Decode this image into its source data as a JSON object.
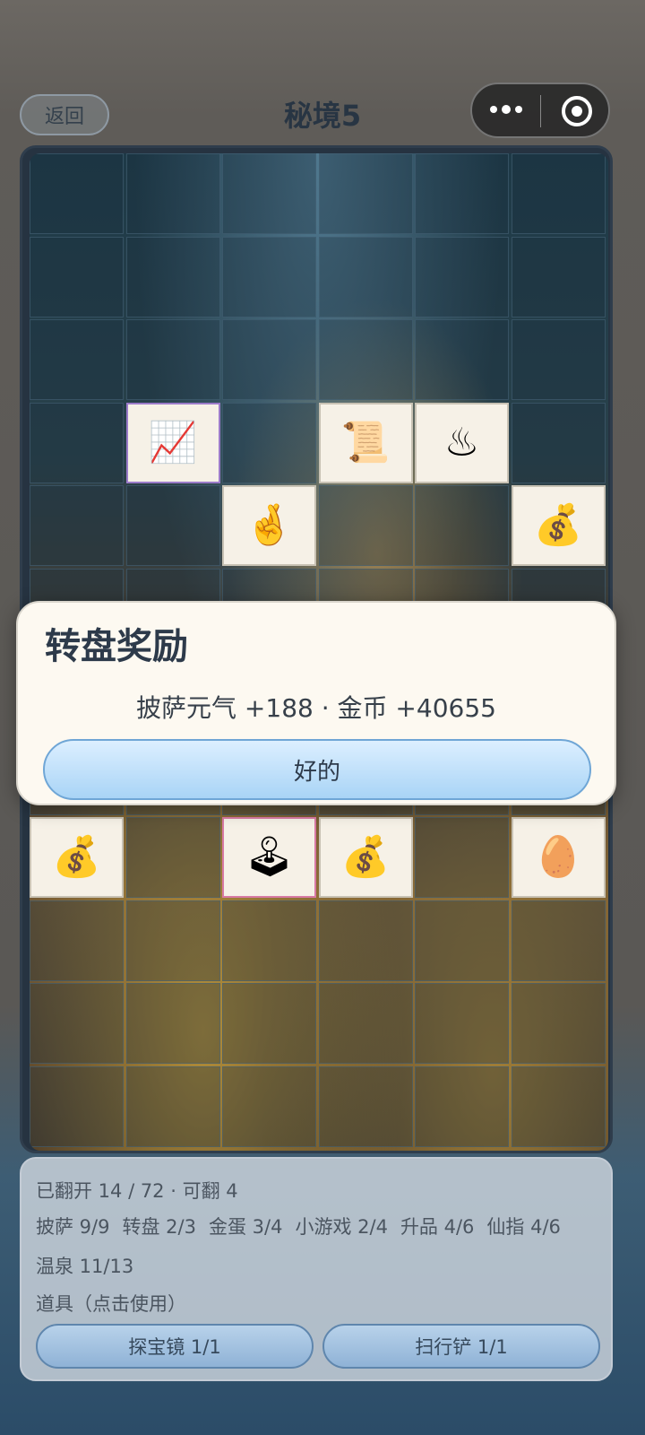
{
  "header": {
    "back_label": "返回",
    "title": "秘境5"
  },
  "board": {
    "revealed_tiles": [
      {
        "name": "upgrade-tile",
        "icon": "upgrade-steps-icon",
        "row": 3,
        "col": 1,
        "glyph": "📈",
        "border": "purple"
      },
      {
        "name": "scroll-tile",
        "icon": "scroll-list-icon",
        "row": 3,
        "col": 3,
        "glyph": "📜",
        "border": "plain"
      },
      {
        "name": "hot-spring-tile",
        "icon": "hot-spring-pool-icon",
        "row": 3,
        "col": 4,
        "glyph": "♨",
        "border": "plain"
      },
      {
        "name": "immortal-finger-tile",
        "icon": "crossed-fingers-icon",
        "row": 4,
        "col": 2,
        "glyph": "🤞",
        "border": "plain"
      },
      {
        "name": "pizza-bag-tile",
        "icon": "money-bag-icon",
        "row": 4,
        "col": 5,
        "glyph": "💰",
        "border": "plain"
      },
      {
        "name": "pizza-bag-tile",
        "icon": "money-bag-icon",
        "row": 8,
        "col": 0,
        "glyph": "💰",
        "border": "plain"
      },
      {
        "name": "arcade-tile",
        "icon": "arcade-machine-icon",
        "row": 8,
        "col": 2,
        "glyph": "🕹",
        "border": "pink"
      },
      {
        "name": "pizza-bag-tile",
        "icon": "money-bag-icon",
        "row": 8,
        "col": 3,
        "glyph": "💰",
        "border": "plain"
      },
      {
        "name": "golden-egg-tile",
        "icon": "golden-egg-icon",
        "row": 8,
        "col": 5,
        "glyph": "🥚",
        "border": "plain"
      }
    ]
  },
  "dialog": {
    "title": "转盘奖励",
    "reward_text": "披萨元气 +188 · 金币 +40655",
    "ok_label": "好的"
  },
  "panel": {
    "progress": "已翻开 14 / 72 · 可翻 4",
    "stats": [
      "披萨 9/9",
      "转盘 2/3",
      "金蛋 3/4",
      "小游戏 2/4",
      "升品 4/6",
      "仙指 4/6"
    ],
    "stats2": "温泉 11/13",
    "items_label": "道具（点击使用）",
    "tool1": "探宝镜 1/1",
    "tool2": "扫行铲 1/1"
  }
}
